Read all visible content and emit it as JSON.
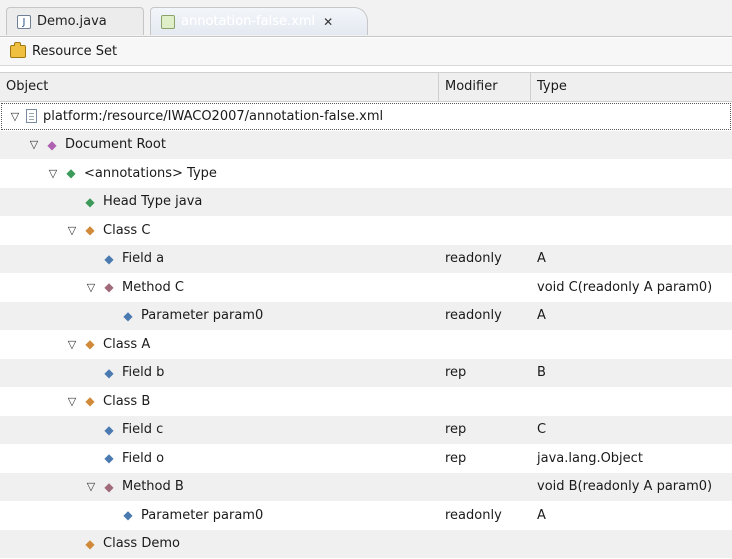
{
  "tabs": [
    {
      "label": "Demo.java",
      "icon": "java-file-icon",
      "active": false
    },
    {
      "label": "annotation-false.xml",
      "icon": "xml-file-icon",
      "active": true,
      "close": "✕"
    }
  ],
  "toolbar": {
    "label": "Resource Set",
    "icon": "resource-set-icon"
  },
  "columns": {
    "object": "Object",
    "modifier": "Modifier",
    "type": "Type"
  },
  "rows": [
    {
      "level": 0,
      "expanded": true,
      "icon": "file-icon",
      "label": "platform:/resource/IWACO2007/annotation-false.xml",
      "modifier": "",
      "type": ""
    },
    {
      "level": 1,
      "expanded": true,
      "icon": "diamond-icon",
      "icon_color": "#b060b0",
      "label": "Document Root",
      "modifier": "",
      "type": ""
    },
    {
      "level": 2,
      "expanded": true,
      "icon": "diamond-icon",
      "icon_color": "#3c9a5a",
      "label": "<annotations> Type",
      "modifier": "",
      "type": ""
    },
    {
      "level": 3,
      "expanded": null,
      "icon": "diamond-icon",
      "icon_color": "#3c9a5a",
      "label": "Head Type java",
      "modifier": "",
      "type": ""
    },
    {
      "level": 3,
      "expanded": true,
      "icon": "diamond-icon",
      "icon_color": "#d08a3a",
      "label": "Class C",
      "modifier": "",
      "type": ""
    },
    {
      "level": 4,
      "expanded": null,
      "icon": "diamond-icon",
      "icon_color": "#4a7ab0",
      "label": "Field a",
      "modifier": "readonly",
      "type": "A"
    },
    {
      "level": 4,
      "expanded": true,
      "icon": "diamond-icon",
      "icon_color": "#a06a7a",
      "label": "Method C",
      "modifier": "",
      "type": "void C(readonly A param0)"
    },
    {
      "level": 5,
      "expanded": null,
      "icon": "diamond-icon",
      "icon_color": "#4a7ab0",
      "label": "Parameter param0",
      "modifier": "readonly",
      "type": "A"
    },
    {
      "level": 3,
      "expanded": true,
      "icon": "diamond-icon",
      "icon_color": "#d08a3a",
      "label": "Class A",
      "modifier": "",
      "type": ""
    },
    {
      "level": 4,
      "expanded": null,
      "icon": "diamond-icon",
      "icon_color": "#4a7ab0",
      "label": "Field b",
      "modifier": "rep",
      "type": "B"
    },
    {
      "level": 3,
      "expanded": true,
      "icon": "diamond-icon",
      "icon_color": "#d08a3a",
      "label": "Class B",
      "modifier": "",
      "type": ""
    },
    {
      "level": 4,
      "expanded": null,
      "icon": "diamond-icon",
      "icon_color": "#4a7ab0",
      "label": "Field c",
      "modifier": "rep",
      "type": "C"
    },
    {
      "level": 4,
      "expanded": null,
      "icon": "diamond-icon",
      "icon_color": "#4a7ab0",
      "label": "Field o",
      "modifier": "rep",
      "type": "java.lang.Object"
    },
    {
      "level": 4,
      "expanded": true,
      "icon": "diamond-icon",
      "icon_color": "#a06a7a",
      "label": "Method B",
      "modifier": "",
      "type": "void B(readonly A param0)"
    },
    {
      "level": 5,
      "expanded": null,
      "icon": "diamond-icon",
      "icon_color": "#4a7ab0",
      "label": "Parameter param0",
      "modifier": "readonly",
      "type": "A"
    },
    {
      "level": 3,
      "expanded": null,
      "icon": "diamond-icon",
      "icon_color": "#d08a3a",
      "label": "Class Demo",
      "modifier": "",
      "type": ""
    }
  ]
}
